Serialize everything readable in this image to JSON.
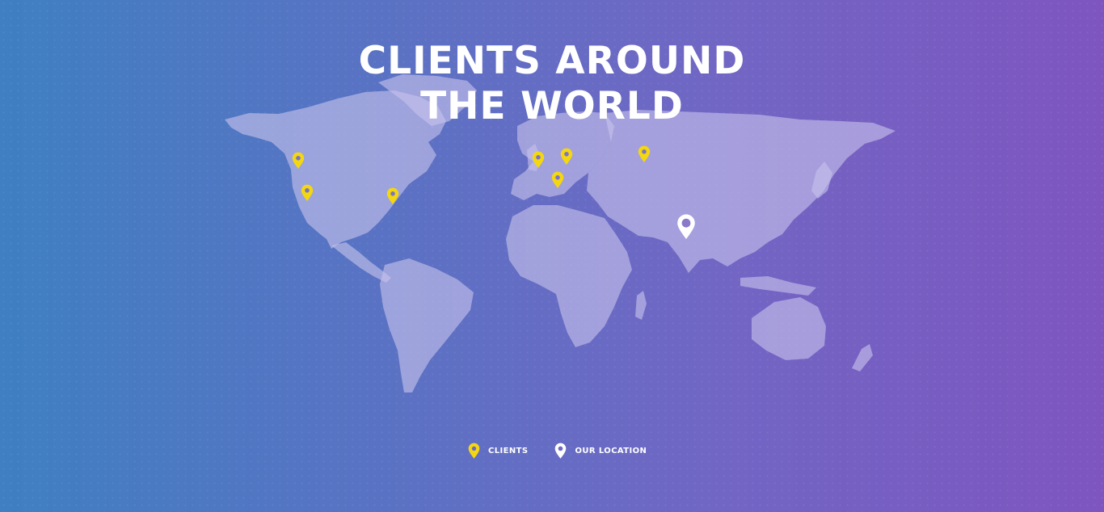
{
  "title": {
    "line1": "CLIENTS AROUND",
    "line2": "THE WORLD"
  },
  "legend": {
    "clients": {
      "label": "CLIENTS",
      "icon": "client-pin-icon",
      "color": "#f5d70f"
    },
    "our_location": {
      "label": "OUR LOCATION",
      "icon": "location-pin-icon",
      "color": "#ffffff"
    }
  },
  "colors": {
    "gradient_left": "#3f7fc2",
    "gradient_right": "#7e55bf",
    "land": "#c6c2ec",
    "client_pin": "#f5d70f",
    "location_pin": "#ffffff"
  }
}
